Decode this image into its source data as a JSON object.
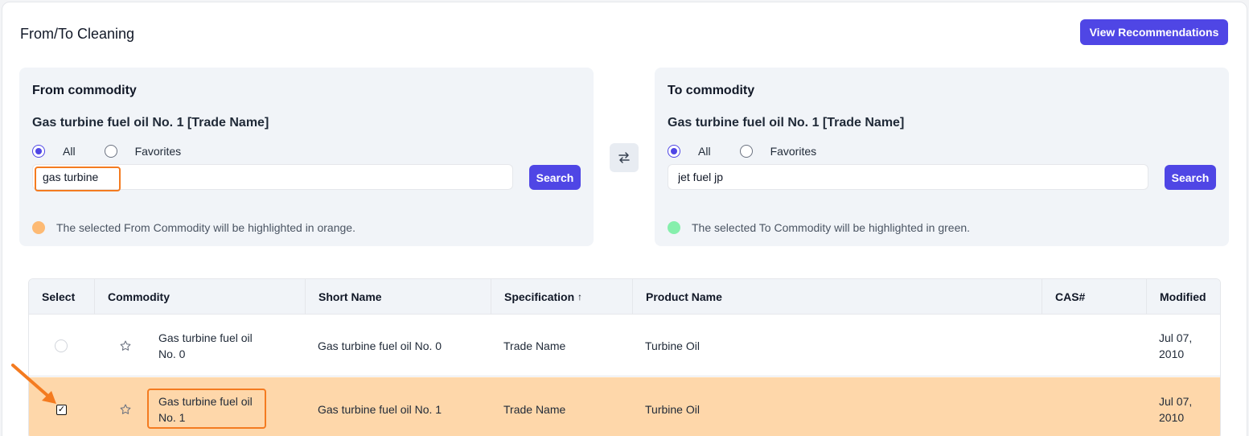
{
  "header": {
    "title": "From/To Cleaning",
    "view_recommendations_label": "View Recommendations"
  },
  "from_panel": {
    "heading": "From commodity",
    "selected": "Gas turbine fuel oil No. 1 [Trade Name]",
    "radio_all": "All",
    "radio_favorites": "Favorites",
    "selected_radio": "All",
    "search_value": "gas turbine",
    "search_button": "Search",
    "hint": "The selected From Commodity will be highlighted in orange.",
    "hint_color": "#fdba74"
  },
  "to_panel": {
    "heading": "To commodity",
    "selected": "Gas turbine fuel oil No. 1 [Trade Name]",
    "radio_all": "All",
    "radio_favorites": "Favorites",
    "selected_radio": "All",
    "search_value": "jet fuel jp",
    "search_button": "Search",
    "hint": "The selected To Commodity will be highlighted in green.",
    "hint_color": "#86efac"
  },
  "swap_icon": "swap-arrows-icon",
  "table": {
    "columns": [
      "Select",
      "Commodity",
      "Short Name",
      "Specification",
      "Product Name",
      "CAS#",
      "Modified"
    ],
    "sort_indicator": "↑",
    "rows": [
      {
        "selected": false,
        "commodity_line1": "Gas turbine fuel oil",
        "commodity_line2": "No. 0",
        "short_name": "Gas turbine fuel oil No. 0",
        "specification": "Trade Name",
        "product_name": "Turbine Oil",
        "cas": "",
        "modified_line1": "Jul 07,",
        "modified_line2": "2010"
      },
      {
        "selected": true,
        "commodity_line1": "Gas turbine fuel oil",
        "commodity_line2": "No. 1",
        "short_name": "Gas turbine fuel oil No. 1",
        "specification": "Trade Name",
        "product_name": "Turbine Oil",
        "cas": "",
        "modified_line1": "Jul 07,",
        "modified_line2": "2010"
      }
    ]
  },
  "colors": {
    "accent": "#4f46e5",
    "from_highlight": "#fed7aa",
    "annotation": "#f47b20"
  }
}
